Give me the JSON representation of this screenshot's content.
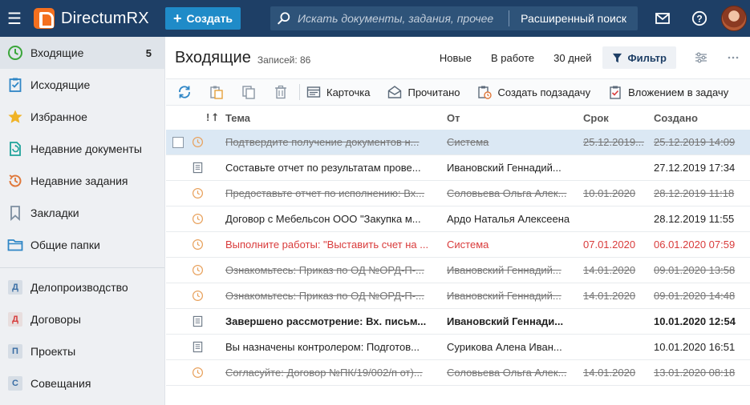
{
  "app": {
    "name": "DirectumRX"
  },
  "topbar": {
    "create_label": "Создать",
    "search_placeholder": "Искать документы, задания, прочее",
    "advanced_search": "Расширенный поиск"
  },
  "sidebar": {
    "items": [
      {
        "label": "Входящие",
        "count": "5",
        "icon": "clock-icon"
      },
      {
        "label": "Исходящие",
        "icon": "checklist-icon"
      },
      {
        "label": "Избранное",
        "icon": "star-icon"
      },
      {
        "label": "Недавние документы",
        "icon": "recent-doc-icon"
      },
      {
        "label": "Недавние задания",
        "icon": "recent-task-icon"
      },
      {
        "label": "Закладки",
        "icon": "bookmark-icon"
      },
      {
        "label": "Общие папки",
        "icon": "folder-icon"
      }
    ],
    "modules": [
      {
        "letter": "Д",
        "label": "Делопроизводство"
      },
      {
        "letter": "Д",
        "label": "Договоры"
      },
      {
        "letter": "П",
        "label": "Проекты"
      },
      {
        "letter": "С",
        "label": "Совещания"
      }
    ]
  },
  "main": {
    "title": "Входящие",
    "records": "Записей: 86",
    "quick_filters": [
      "Новые",
      "В работе",
      "30 дней"
    ],
    "filter_label": "Фильтр"
  },
  "toolbar": {
    "card": "Карточка",
    "read": "Прочитано",
    "subtask": "Создать подзадачу",
    "attach": "Вложением в задачу"
  },
  "grid": {
    "headers": {
      "flags": "! ⭡",
      "theme": "Тема",
      "from": "От",
      "due": "Срок",
      "created": "Создано"
    },
    "rows": [
      {
        "theme": "Подтвердите получение документов н...",
        "from": "Система",
        "due": "25.12.2019...",
        "created": "25.12.2019 14:09",
        "icon": "clock-icon",
        "state": "done selected"
      },
      {
        "theme": "Составьте отчет по результатам прове...",
        "from": "Ивановский Геннадий...",
        "due": "",
        "created": "27.12.2019 17:34",
        "icon": "document-icon",
        "state": ""
      },
      {
        "theme": "Предоставьте отчет по исполнению: Вх...",
        "from": "Соловьева Ольга Алек...",
        "due": "10.01.2020",
        "created": "28.12.2019 11:18",
        "icon": "clock-icon",
        "state": "done"
      },
      {
        "theme": "Договор с Мебельсон ООО \"Закупка м...",
        "from": "Ардо Наталья Алексеена",
        "due": "",
        "created": "28.12.2019 11:55",
        "icon": "clock-icon",
        "state": ""
      },
      {
        "theme": "Выполните работы: \"Выставить счет на ...",
        "from": "Система",
        "due": "07.01.2020",
        "created": "06.01.2020 07:59",
        "icon": "clock-icon",
        "state": "overdue"
      },
      {
        "theme": "Ознакомьтесь: Приказ по ОД №ОРД-П-...",
        "from": "Ивановский Геннадий...",
        "due": "14.01.2020",
        "created": "09.01.2020 13:58",
        "icon": "clock-icon",
        "state": "done"
      },
      {
        "theme": "Ознакомьтесь: Приказ по ОД №ОРД-П-...",
        "from": "Ивановский Геннадий...",
        "due": "14.01.2020",
        "created": "09.01.2020 14:48",
        "icon": "clock-icon",
        "state": "done"
      },
      {
        "theme": "Завершено рассмотрение: Вх. письм...",
        "from": "Ивановский Геннади...",
        "due": "",
        "created": "10.01.2020 12:54",
        "icon": "document-icon",
        "state": "bold"
      },
      {
        "theme": "Вы назначены контролером: Подготов...",
        "from": "Сурикова Алена Иван...",
        "due": "",
        "created": "10.01.2020 16:51",
        "icon": "document-icon",
        "state": ""
      },
      {
        "theme": "Согласуйте: Договор №ПК/19/002/п от)...",
        "from": "Соловьева Ольга Алек...",
        "due": "14.01.2020",
        "created": "13.01.2020 08:18",
        "icon": "clock-icon",
        "state": "done"
      }
    ]
  },
  "colors": {
    "topbar": "#1e3f66",
    "accent": "#1f8bc8",
    "logo": "#f4701f",
    "overdue": "#d93b3b",
    "selected_row": "#dbe8f4"
  }
}
